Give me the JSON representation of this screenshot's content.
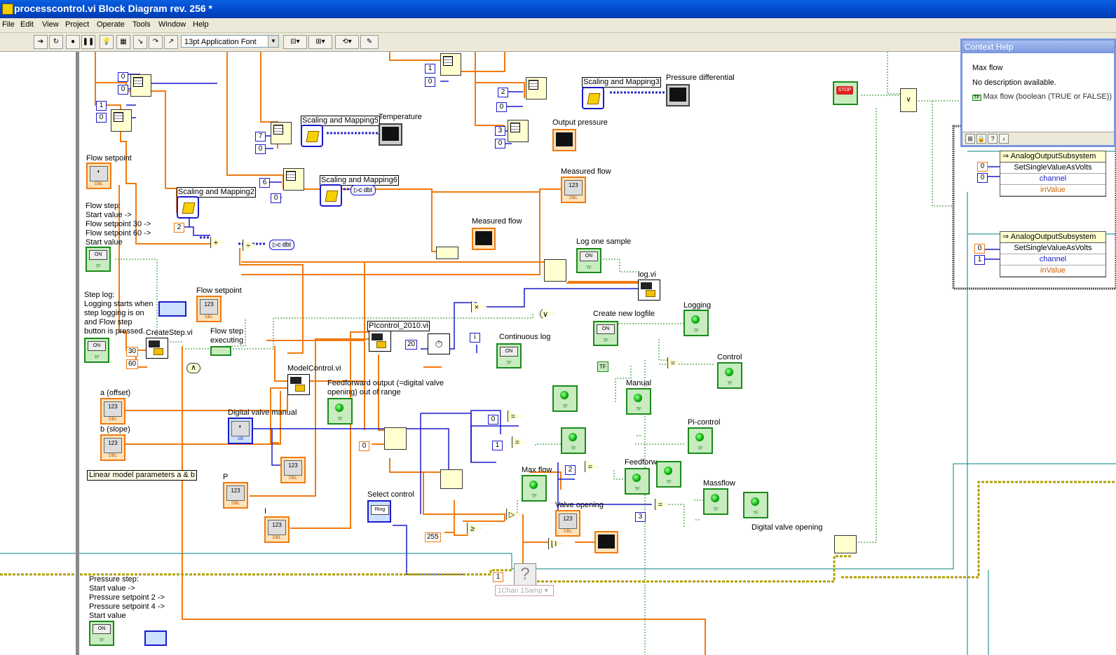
{
  "window": {
    "title": "processcontrol.vi Block Diagram rev. 256 *"
  },
  "menu": [
    "File",
    "Edit",
    "View",
    "Project",
    "Operate",
    "Tools",
    "Window",
    "Help"
  ],
  "toolbar": {
    "font": "13pt Application Font"
  },
  "context_help": {
    "title": "Context Help",
    "name": "Max flow",
    "description": "No description available.",
    "detail_tag": "TF",
    "detail": "Max flow (boolean (TRUE or FALSE))"
  },
  "labels": {
    "scaling2": "Scaling and Mapping2",
    "scaling3": "Scaling and Mapping3",
    "scaling5": "Scaling and Mapping5",
    "scaling6": "Scaling and Mapping6",
    "pressure_diff": "Pressure differential",
    "temperature": "Temperature",
    "output_pressure": "Output pressure",
    "measured_flow_1": "Measured flow",
    "measured_flow_2": "Measured flow",
    "flow_setpoint": "Flow setpoint",
    "flow_step": "Flow step:\nStart value ->\nFlow setpoint 30 ->\nFlow setpoint 60 ->\nStart value",
    "step_log": "Step log:\nLogging starts when\nstep logging is on\nand Flow step\nbutton is pressed.",
    "flow_setpoint_2": "Flow setpoint",
    "createstep": "CreateStep.vi",
    "flow_step_exec": "Flow step\nexecuting",
    "log_one_sample": "Log one sample",
    "log_vi": "log.vi",
    "create_logfile": "Create new logfile",
    "logging": "Logging",
    "picontrol": "PIcontrol_2010.vi",
    "continuous_log": "Continuous log",
    "control": "Control",
    "manual": "Manual",
    "modelcontrol": "ModelControl.vi",
    "feedforward_out": "Feedforward output (=digital valve\nopening) out of range",
    "a_offset": "a (offset)",
    "b_slope": "b (slope)",
    "digital_valve_manual": "Digital valve manual",
    "linear_model": "Linear model parameters a & b",
    "p": "P",
    "i": "I",
    "pi_control": "Pi-control",
    "feedforw": "Feedforw",
    "massflow": "Massflow",
    "max_flow": "Max flow",
    "valve_opening": "Valve opening",
    "select_control": "Select control",
    "digital_valve_opening": "Digital valve opening",
    "pressure_step": "Pressure step:\nStart value ->\nPressure setpoint 2 ->\nPressure setpoint 4 ->\nStart value",
    "daq_mode": "1Chan 1Samp",
    "ao1_title": "AnalogOutputSubsystem",
    "ao1_method": "SetSingleValueAsVolts",
    "ao1_channel": "channel",
    "ao1_value": "inValue",
    "ao2_title": "AnalogOutputSubsystem",
    "ao2_method": "SetSingleValueAsVolts",
    "ao2_channel": "channel",
    "ao2_value": "inValue"
  },
  "constants": {
    "c0a": "0",
    "c0b": "0",
    "c1a": "1",
    "c0c": "0",
    "c1b": "1",
    "c0d": "0",
    "c2a": "2",
    "c0e": "0",
    "c3a": "3",
    "c0f": "0",
    "c7": "7",
    "c0g": "0",
    "c6": "6",
    "c0h": "0",
    "c2b": "2",
    "c30": "30",
    "c60": "60",
    "c20": "20",
    "ci": "i",
    "c0i": "0",
    "c1c": "1",
    "c0j": "0",
    "c2c": "2",
    "c3b": "3",
    "c255": "255",
    "c1d": "1",
    "ao1_c0": "0",
    "ao1_c0b": "0",
    "ao2_c0": "0",
    "ao2_c1": "1"
  },
  "terminal_tags": {
    "dbl": "DBL",
    "tf": "TF",
    "u8": "U8",
    "n123": "123",
    "on": "ON",
    "ring": "Ring",
    "stop": "STOP"
  }
}
